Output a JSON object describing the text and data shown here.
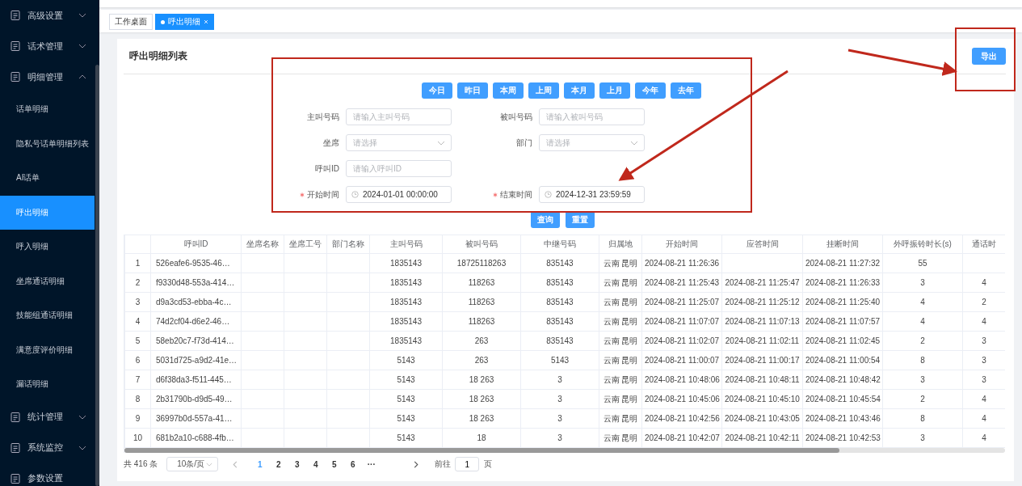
{
  "sidebar": {
    "items": [
      {
        "label": "高级设置",
        "expanded": false
      },
      {
        "label": "话术管理",
        "expanded": false
      },
      {
        "label": "明细管理",
        "expanded": true,
        "children": [
          {
            "label": "话单明细",
            "selected": false
          },
          {
            "label": "隐私号话单明细列表",
            "selected": false
          },
          {
            "label": "AI话单",
            "selected": false
          },
          {
            "label": "呼出明细",
            "selected": true
          },
          {
            "label": "呼入明细",
            "selected": false
          },
          {
            "label": "坐席通话明细",
            "selected": false
          },
          {
            "label": "技能组通话明细",
            "selected": false
          },
          {
            "label": "满意度评价明细",
            "selected": false
          },
          {
            "label": "漏话明细",
            "selected": false
          }
        ]
      },
      {
        "label": "统计管理",
        "expanded": false
      },
      {
        "label": "系统监控",
        "expanded": false
      },
      {
        "label": "参数设置"
      }
    ]
  },
  "tabs": [
    {
      "label": "工作桌面",
      "selected": false
    },
    {
      "label": "呼出明细",
      "selected": true
    }
  ],
  "card": {
    "title": "呼出明细列表",
    "export_button": "导出"
  },
  "date_buttons": [
    "今日",
    "昨日",
    "本周",
    "上周",
    "本月",
    "上月",
    "今年",
    "去年"
  ],
  "form": {
    "fields": [
      {
        "label": "主叫号码",
        "kind": "input",
        "placeholder": "请输入主叫号码",
        "required": false
      },
      {
        "label": "被叫号码",
        "kind": "input",
        "placeholder": "请输入被叫号码",
        "required": false
      },
      {
        "label": "坐席",
        "kind": "select",
        "placeholder": "请选择",
        "required": false
      },
      {
        "label": "部门",
        "kind": "select",
        "placeholder": "请选择",
        "required": false
      },
      {
        "label": "呼叫ID",
        "kind": "input",
        "placeholder": "请输入呼叫ID",
        "required": false
      },
      {
        "kind": "empty"
      },
      {
        "label": "开始时间",
        "kind": "date",
        "value": "2024-01-01 00:00:00",
        "required": true
      },
      {
        "label": "结束时间",
        "kind": "date",
        "value": "2024-12-31 23:59:59",
        "required": true
      }
    ],
    "buttons": [
      "查询",
      "重置"
    ]
  },
  "table": {
    "columns": [
      "",
      "呼叫ID",
      "坐席名称",
      "坐席工号",
      "部门名称",
      "主叫号码",
      "被叫号码",
      "中继号码",
      "归属地",
      "开始时间",
      "应答时间",
      "挂断时间",
      "外呼振铃时长(s)",
      "通话时"
    ],
    "rows": [
      [
        "1",
        "526eafe6-9535-46…",
        "",
        "",
        "",
        "1835143",
        "18725118263",
        "835143",
        "云南 昆明",
        "2024-08-21 11:26:36",
        "",
        "2024-08-21 11:27:32",
        "55",
        ""
      ],
      [
        "2",
        "f9330d48-553a-414…",
        "",
        "",
        "",
        "1835143",
        "118263",
        "835143",
        "云南 昆明",
        "2024-08-21 11:25:43",
        "2024-08-21 11:25:47",
        "2024-08-21 11:26:33",
        "3",
        "4"
      ],
      [
        "3",
        "d9a3cd53-ebba-4c…",
        "",
        "",
        "",
        "1835143",
        "118263",
        "835143",
        "云南 昆明",
        "2024-08-21 11:25:07",
        "2024-08-21 11:25:12",
        "2024-08-21 11:25:40",
        "4",
        "2"
      ],
      [
        "4",
        "74d2cf04-d6e2-46…",
        "",
        "",
        "",
        "1835143",
        "118263",
        "835143",
        "云南 昆明",
        "2024-08-21 11:07:07",
        "2024-08-21 11:07:13",
        "2024-08-21 11:07:57",
        "4",
        "4"
      ],
      [
        "5",
        "58eb20c7-f73d-414…",
        "",
        "",
        "",
        "1835143",
        "263",
        "835143",
        "云南 昆明",
        "2024-08-21 11:02:07",
        "2024-08-21 11:02:11",
        "2024-08-21 11:02:45",
        "2",
        "3"
      ],
      [
        "6",
        "5031d725-a9d2-41e…",
        "",
        "",
        "",
        "5143",
        "263",
        "5143",
        "云南 昆明",
        "2024-08-21 11:00:07",
        "2024-08-21 11:00:17",
        "2024-08-21 11:00:54",
        "8",
        "3"
      ],
      [
        "7",
        "d6f38da3-f511-445…",
        "",
        "",
        "",
        "5143",
        "18 263",
        "3",
        "云南 昆明",
        "2024-08-21 10:48:06",
        "2024-08-21 10:48:11",
        "2024-08-21 10:48:42",
        "3",
        "3"
      ],
      [
        "8",
        "2b31790b-d9d5-49…",
        "",
        "",
        "",
        "5143",
        "18 263",
        "3",
        "云南 昆明",
        "2024-08-21 10:45:06",
        "2024-08-21 10:45:10",
        "2024-08-21 10:45:54",
        "2",
        "4"
      ],
      [
        "9",
        "36997b0d-557a-41…",
        "",
        "",
        "",
        "5143",
        "18 263",
        "3",
        "云南 昆明",
        "2024-08-21 10:42:56",
        "2024-08-21 10:43:05",
        "2024-08-21 10:43:46",
        "8",
        "4"
      ],
      [
        "10",
        "681b2a10-c688-4fb…",
        "",
        "",
        "",
        "5143",
        "18",
        "3",
        "云南 昆明",
        "2024-08-21 10:42:07",
        "2024-08-21 10:42:11",
        "2024-08-21 10:42:53",
        "3",
        "4"
      ]
    ]
  },
  "pagination": {
    "total": "共 416 条",
    "page_size": "10条/页",
    "pages": [
      {
        "label": "1",
        "selected": true
      },
      {
        "label": "2",
        "selected": false
      },
      {
        "label": "3",
        "selected": false
      },
      {
        "label": "4",
        "selected": false
      },
      {
        "label": "5",
        "selected": false
      },
      {
        "label": "6",
        "selected": false
      }
    ],
    "more": "···",
    "goto_label": "前往",
    "goto_value": "1",
    "goto_suffix": "页"
  }
}
